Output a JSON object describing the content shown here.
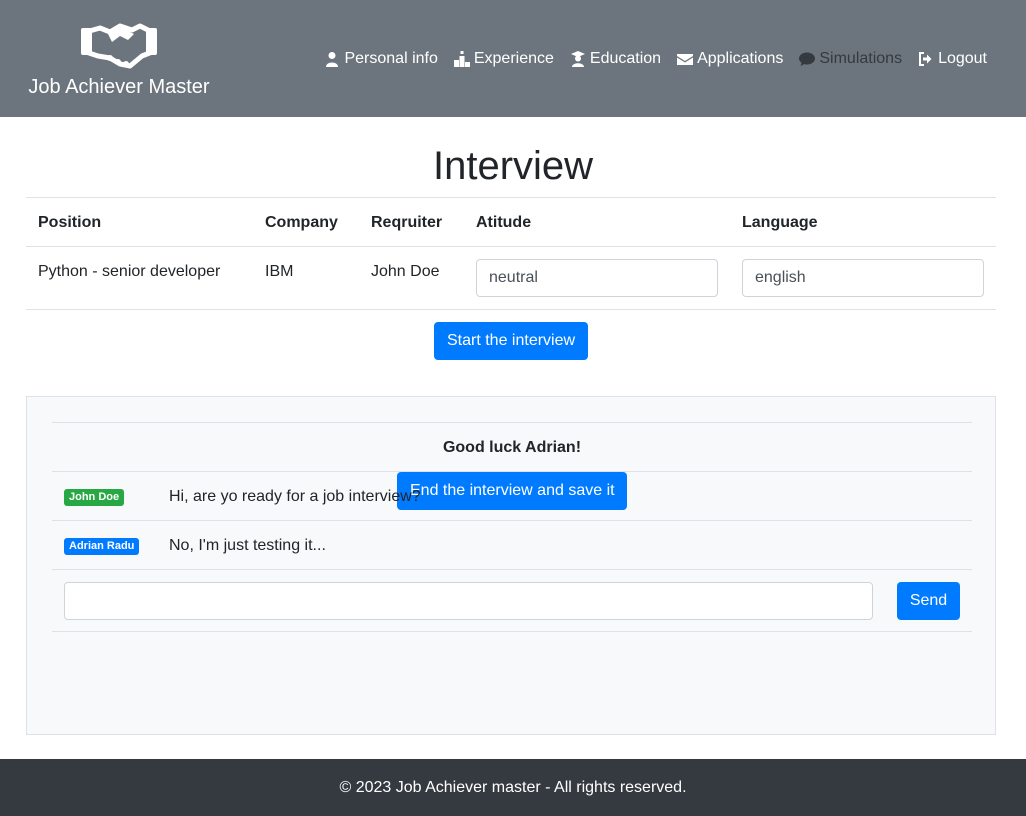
{
  "header": {
    "brand": "Job Achiever Master",
    "logo_icon": "handshake-icon",
    "nav": [
      {
        "label": "Personal info",
        "icon": "user-icon"
      },
      {
        "label": "Experience",
        "icon": "podium-icon"
      },
      {
        "label": "Education",
        "icon": "graduate-icon"
      },
      {
        "label": "Applications",
        "icon": "envelope-icon"
      },
      {
        "label": "Simulations",
        "icon": "chat-bubble-icon",
        "active": true
      },
      {
        "label": "Logout",
        "icon": "logout-icon"
      }
    ],
    "background_color": "#6c757d",
    "active_color": "#343a40"
  },
  "main": {
    "title": "Interview",
    "table": {
      "headers": [
        "Position",
        "Company",
        "Reqruiter",
        "Atitude",
        "Language"
      ],
      "row": {
        "position": "Python - senior developer",
        "company": "IBM",
        "recruiter": "John Doe",
        "attitude": "neutral",
        "language": "english"
      }
    },
    "start_button": "Start the interview",
    "accent_color": "#007bff"
  },
  "chat": {
    "greeting": "Good luck Adrian!",
    "messages": [
      {
        "sender": "John Doe",
        "text": "Hi, are yo ready for a job interview?",
        "badge_color": "#28a745"
      },
      {
        "sender": "Adrian Radu",
        "text": "No, I'm just testing it...",
        "badge_color": "#007bff"
      }
    ],
    "input_value": "",
    "send_button": "Send",
    "end_button": "End the interview and save it"
  },
  "footer": {
    "text": "© 2023 Job Achiever master - All rights reserved.",
    "background_color": "#343a40"
  }
}
